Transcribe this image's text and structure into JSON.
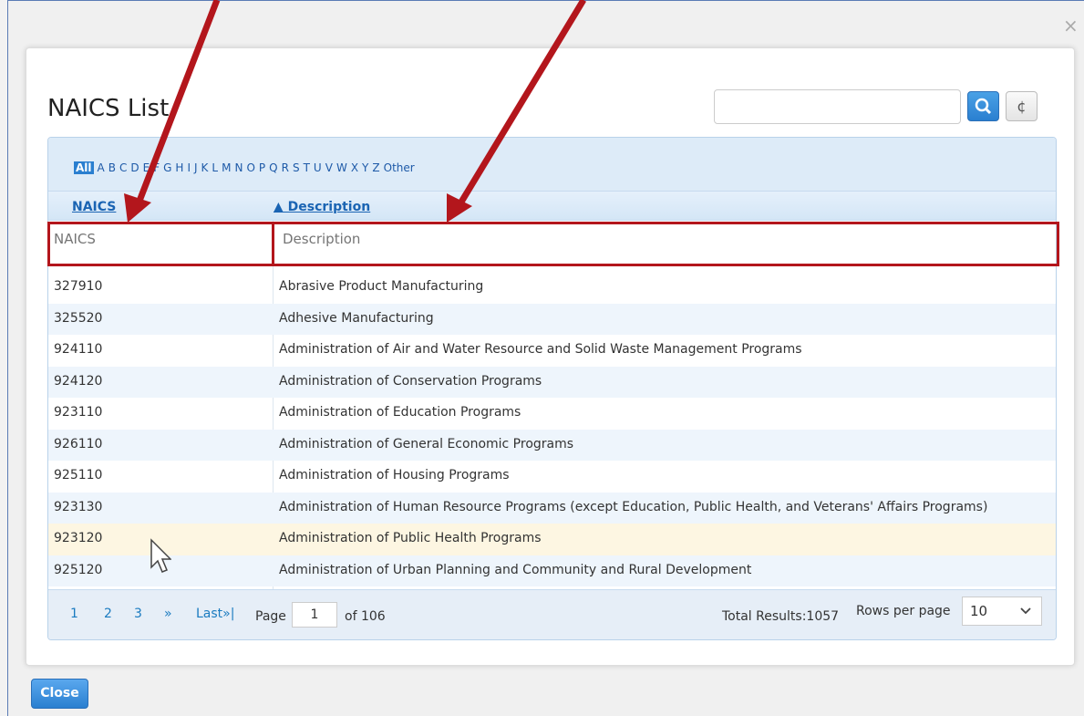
{
  "dialog": {
    "title": "NAICS List",
    "close_glyph": "×",
    "refresh_glyph": "¢",
    "search_placeholder": ""
  },
  "alphabet": [
    "All",
    "A",
    "B",
    "C",
    "D",
    "E",
    "F",
    "G",
    "H",
    "I",
    "J",
    "K",
    "L",
    "M",
    "N",
    "O",
    "P",
    "Q",
    "R",
    "S",
    "T",
    "U",
    "V",
    "W",
    "X",
    "Y",
    "Z",
    "Other"
  ],
  "columns": {
    "naics": "NAICS",
    "description": "▲ Description"
  },
  "filters": {
    "naics_placeholder": "NAICS",
    "description_placeholder": "Description"
  },
  "rows": [
    {
      "code": "327910",
      "desc": "Abrasive Product Manufacturing"
    },
    {
      "code": "325520",
      "desc": "Adhesive Manufacturing"
    },
    {
      "code": "924110",
      "desc": "Administration of Air and Water Resource and Solid Waste Management Programs"
    },
    {
      "code": "924120",
      "desc": "Administration of Conservation Programs"
    },
    {
      "code": "923110",
      "desc": "Administration of Education Programs"
    },
    {
      "code": "926110",
      "desc": "Administration of General Economic Programs"
    },
    {
      "code": "925110",
      "desc": "Administration of Housing Programs"
    },
    {
      "code": "923130",
      "desc": "Administration of Human Resource Programs (except Education, Public Health, and Veterans' Affairs Programs)"
    },
    {
      "code": "923120",
      "desc": "Administration of Public Health Programs"
    },
    {
      "code": "925120",
      "desc": "Administration of Urban Planning and Community and Rural Development"
    }
  ],
  "pager": {
    "pages": [
      "1",
      "2",
      "3"
    ],
    "next": "»",
    "last": "Last»|",
    "page_label": "Page",
    "page_value": "1",
    "of_label": "of 106",
    "total": "Total Results:1057",
    "rows_label": "Rows per page",
    "rows_value": "10"
  },
  "footer": {
    "close_label": "Close"
  },
  "colors": {
    "annotation_red": "#b3161c",
    "accent_blue": "#2a7fd0"
  }
}
